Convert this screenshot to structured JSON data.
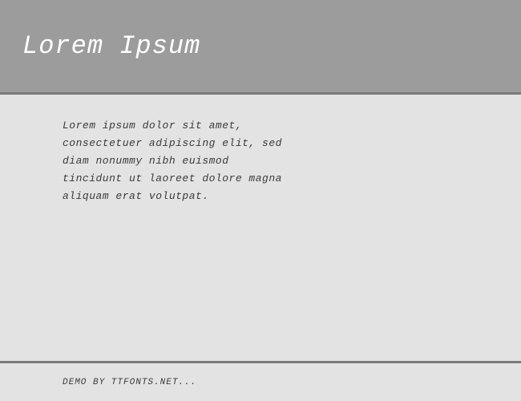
{
  "header": {
    "title": "Lorem Ipsum"
  },
  "content": {
    "body": "Lorem ipsum dolor sit amet, consectetuer adipiscing elit, sed diam nonummy nibh euismod tincidunt ut laoreet dolore magna aliquam erat volutpat."
  },
  "footer": {
    "text": "DEMO BY TTFONTS.NET..."
  }
}
